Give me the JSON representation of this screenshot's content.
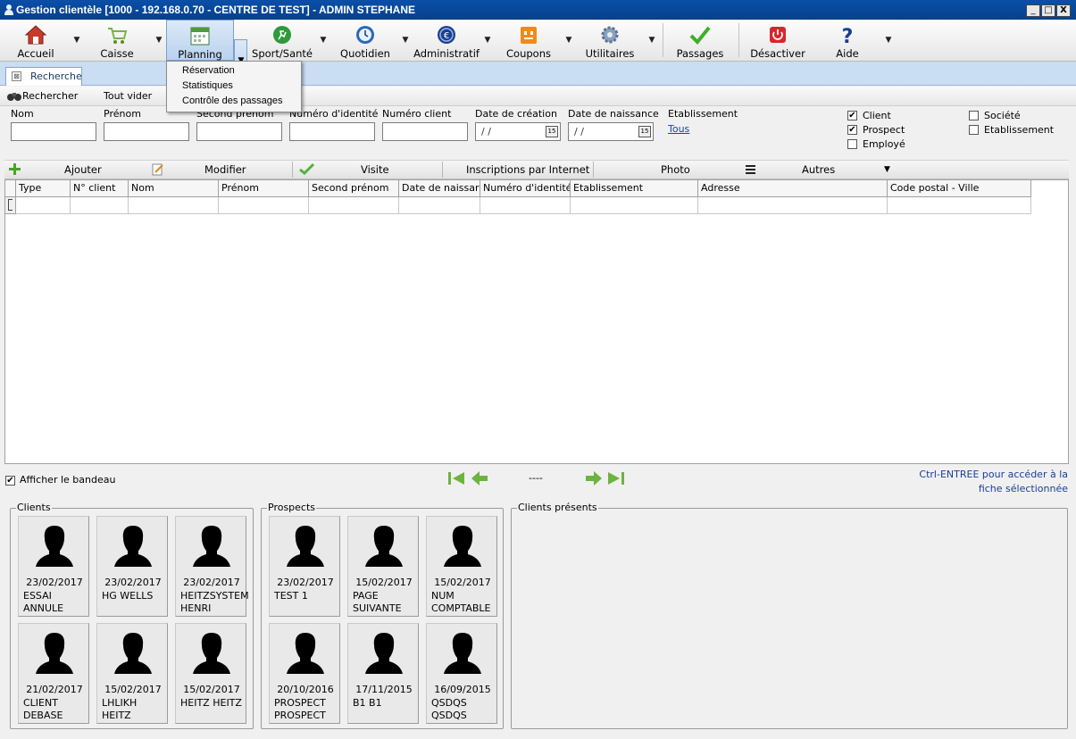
{
  "window": {
    "title": "Gestion clientèle [1000 - 192.168.0.70 - CENTRE DE TEST] - ADMIN STEPHANE",
    "min": "_",
    "max": "□",
    "close": "X"
  },
  "toolbar": {
    "accueil": "Accueil",
    "caisse": "Caisse",
    "planning": "Planning",
    "sport": "Sport/Santé",
    "quotidien": "Quotidien",
    "administratif": "Administratif",
    "coupons": "Coupons",
    "utilitaires": "Utilitaires",
    "passages": "Passages",
    "desactiver": "Désactiver",
    "aide": "Aide",
    "arrow": "▼"
  },
  "planning_menu": [
    "Réservation",
    "Statistiques",
    "Contrôle des passages"
  ],
  "tab": {
    "label": "Recherche",
    "close": "⊠"
  },
  "search_bar": {
    "rechercher": "Rechercher",
    "tout_vider": "Tout vider"
  },
  "fields": {
    "nom": "Nom",
    "prenom": "Prénom",
    "second_prenom": "Second prénom",
    "numero_identite": "Numéro d'identité",
    "numero_client": "Numéro client",
    "date_creation": "Date de création",
    "date_naissance": "Date de naissance",
    "date_placeholder": "/ /",
    "calendar": "15",
    "etablissement": "Etablissement",
    "tous": "Tous"
  },
  "checkboxes": {
    "client": {
      "label": "Client",
      "checked": "✔"
    },
    "prospect": {
      "label": "Prospect",
      "checked": "✔"
    },
    "employe": {
      "label": "Employé",
      "checked": ""
    },
    "societe": {
      "label": "Société",
      "checked": ""
    },
    "etablissement": {
      "label": "Etablissement",
      "checked": ""
    }
  },
  "actions": {
    "ajouter": "Ajouter",
    "modifier": "Modifier",
    "visite": "Visite",
    "inscriptions": "Inscriptions par Internet",
    "photo": "Photo",
    "autres": "Autres",
    "autres_arrow": "▼"
  },
  "grid_columns": [
    "Type",
    "N° client",
    "Nom",
    "Prénom",
    "Second prénom",
    "Date de naissar",
    "Numéro d'identité",
    "Etablissement",
    "Adresse",
    "Code postal - Ville"
  ],
  "bottom": {
    "afficher_bandeau": "Afficher le bandeau",
    "afficher_checked": "✔",
    "page_indicator": "----",
    "hint_line1": "Ctrl-ENTREE pour accéder à la",
    "hint_line2": "fiche sélectionnée"
  },
  "groups": {
    "clients_title": "Clients",
    "prospects_title": "Prospects",
    "presents_title": "Clients présents"
  },
  "clients": [
    {
      "date": "23/02/2017",
      "name": "ESSAI ANNULE"
    },
    {
      "date": "23/02/2017",
      "name": "HG WELLS"
    },
    {
      "date": "23/02/2017",
      "name": "HEITZSYSTEM HENRI"
    },
    {
      "date": "21/02/2017",
      "name": "CLIENT DEBASE"
    },
    {
      "date": "15/02/2017",
      "name": "LHLIKH HEITZ"
    },
    {
      "date": "15/02/2017",
      "name": "HEITZ HEITZ"
    }
  ],
  "prospects": [
    {
      "date": "23/02/2017",
      "name": "TEST 1"
    },
    {
      "date": "15/02/2017",
      "name": "PAGE SUIVANTE"
    },
    {
      "date": "15/02/2017",
      "name": "NUM COMPTABLE"
    },
    {
      "date": "20/10/2016",
      "name": "PROSPECT PROSPECT"
    },
    {
      "date": "17/11/2015",
      "name": "B1 B1"
    },
    {
      "date": "16/09/2015",
      "name": "QSDQS QSDQS"
    }
  ]
}
